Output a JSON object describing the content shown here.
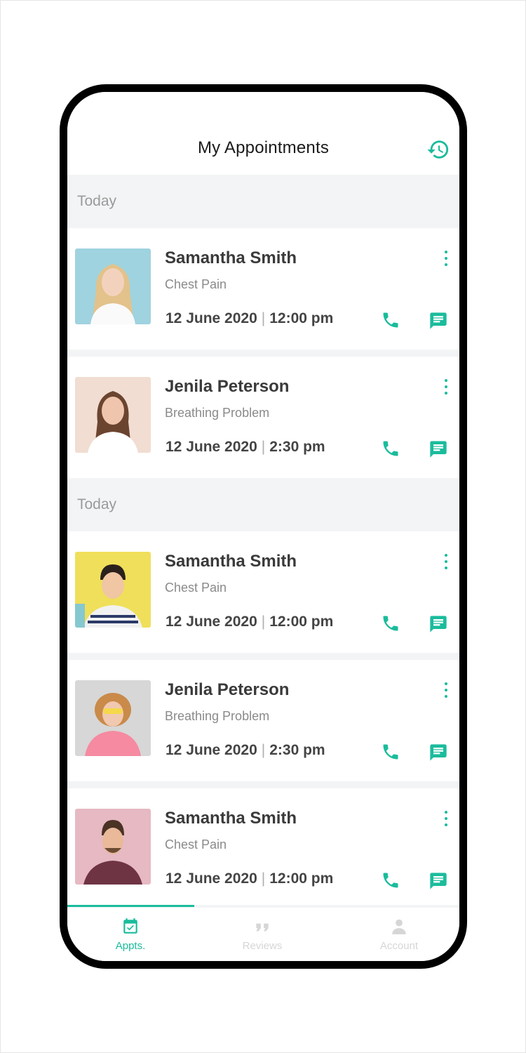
{
  "header": {
    "title": "My Appointments",
    "history_icon": "history-icon"
  },
  "accent_color": "#1abc9c",
  "sections": [
    {
      "label": "Today",
      "appointments": [
        {
          "name": "Samantha Smith",
          "issue": "Chest Pain",
          "date": "12 June 2020",
          "time": "12:00 pm",
          "photo_bg": "#9fd3df"
        },
        {
          "name": "Jenila Peterson",
          "issue": "Breathing Problem",
          "date": "12 June 2020",
          "time": "2:30 pm",
          "photo_bg": "#f1ddd2"
        }
      ]
    },
    {
      "label": "Today",
      "appointments": [
        {
          "name": "Samantha Smith",
          "issue": "Chest Pain",
          "date": "12 June 2020",
          "time": "12:00 pm",
          "photo_bg": "#f0df5a"
        },
        {
          "name": "Jenila Peterson",
          "issue": "Breathing Problem",
          "date": "12 June 2020",
          "time": "2:30 pm",
          "photo_bg": "#d7d7d7"
        },
        {
          "name": "Samantha Smith",
          "issue": "Chest Pain",
          "date": "12 June 2020",
          "time": "12:00 pm",
          "photo_bg": "#e6b9c3"
        }
      ]
    }
  ],
  "tabs": [
    {
      "label": "Appts.",
      "icon": "calendar-check-icon",
      "active": true
    },
    {
      "label": "Reviews",
      "icon": "reviews-icon",
      "active": false
    },
    {
      "label": "Account",
      "icon": "account-icon",
      "active": false
    }
  ]
}
